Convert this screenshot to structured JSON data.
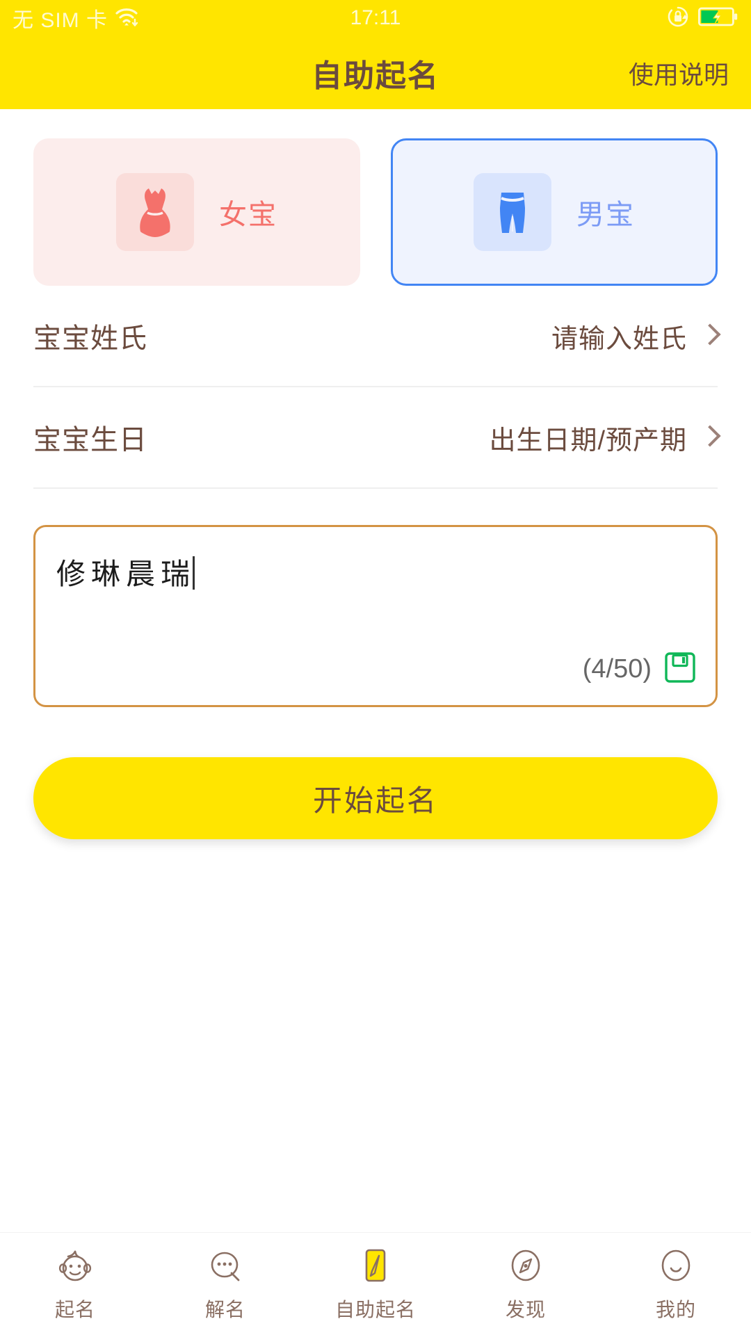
{
  "statusbar": {
    "carrier": "无 SIM 卡",
    "time": "17:11",
    "wifi_icon": "wifi-icon",
    "rotation_lock_icon": "rotation-lock-icon",
    "battery_icon": "battery-charging-icon",
    "battery_color": "#00C853"
  },
  "header": {
    "title": "自助起名",
    "action_label": "使用说明",
    "background": "#FFE500",
    "text_color": "#6B4B3E"
  },
  "gender": {
    "female": {
      "label": "女宝",
      "icon": "dress-icon",
      "selected": false,
      "bg": "#FCEDEC",
      "accent": "#F4716B"
    },
    "male": {
      "label": "男宝",
      "icon": "shorts-icon",
      "selected": true,
      "bg": "#EFF3FE",
      "accent": "#4285F4"
    }
  },
  "form": {
    "rows": [
      {
        "label": "宝宝姓氏",
        "value": "请输入姓氏",
        "chevron": "chevron-right-icon"
      },
      {
        "label": "宝宝生日",
        "value": "出生日期/预产期",
        "chevron": "chevron-right-icon"
      }
    ]
  },
  "textarea": {
    "value": "修琳晨瑞",
    "counter": "(4/50)",
    "save_icon": "save-floppy-icon",
    "save_icon_color": "#10B758",
    "border_color": "#D39344"
  },
  "cta": {
    "label": "开始起名",
    "background": "#FFE500",
    "text_color": "#6B4B3E"
  },
  "tabbar": {
    "items": [
      {
        "label": "起名",
        "icon": "baby-face-icon",
        "active": false
      },
      {
        "label": "解名",
        "icon": "chat-bubble-icon",
        "active": false
      },
      {
        "label": "自助起名",
        "icon": "pencil-icon",
        "active": true
      },
      {
        "label": "发现",
        "icon": "compass-icon",
        "active": false
      },
      {
        "label": "我的",
        "icon": "smiley-icon",
        "active": false
      }
    ],
    "text_color": "#8A6F63",
    "active_bg": "#FFE500"
  }
}
